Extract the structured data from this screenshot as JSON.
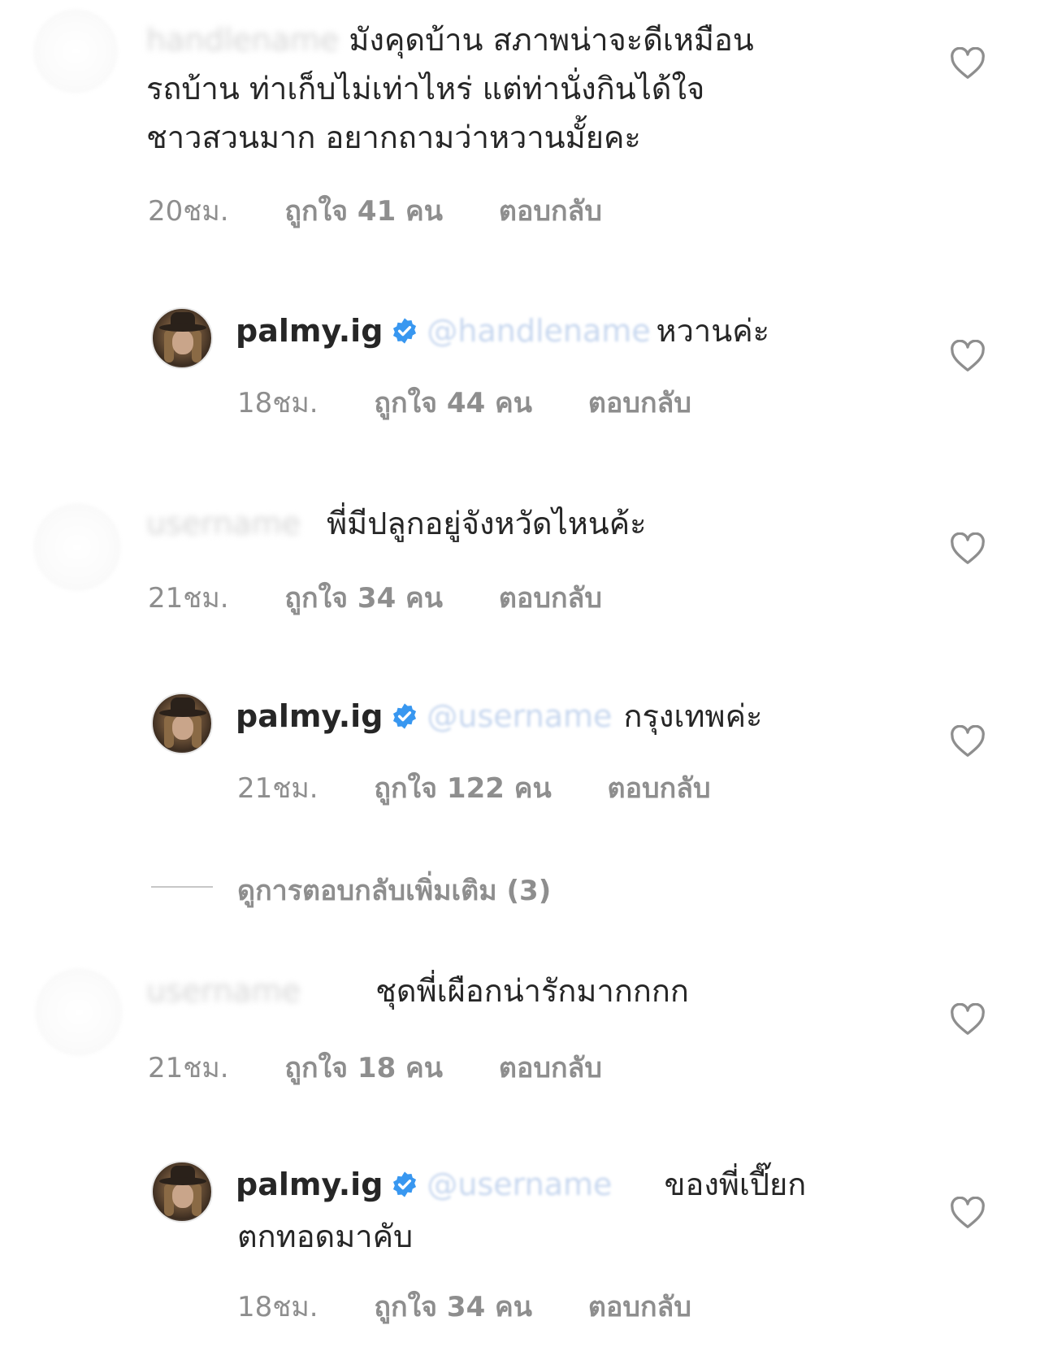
{
  "comments": [
    {
      "username_blurred": "handlename",
      "text_lines": [
        "มังคุดบ้าน สภาพน่าจะดีเหมือน",
        "รถบ้าน ท่าเก็บไม่เท่าไหร่ แต่ท่านั่งกินได้ใจ",
        "ชาวสวนมาก อยากถามว่าหวานมั้ยคะ"
      ],
      "time": "20ชม.",
      "likes": "ถูกใจ 41 คน",
      "reply": "ตอบกลับ"
    },
    {
      "username": "palmy.ig",
      "mention_blurred": "@handlename",
      "text": "หวานค่ะ",
      "time": "18ชม.",
      "likes": "ถูกใจ 44 คน",
      "reply": "ตอบกลับ"
    },
    {
      "username_blurred": "username",
      "text": "พี่มีปลูกอยู่จังหวัดไหนค้ะ",
      "time": "21ชม.",
      "likes": "ถูกใจ 34 คน",
      "reply": "ตอบกลับ"
    },
    {
      "username": "palmy.ig",
      "mention_blurred": "@username",
      "text": "กรุงเทพค่ะ",
      "time": "21ชม.",
      "likes": "ถูกใจ 122 คน",
      "reply": "ตอบกลับ"
    },
    {
      "username_blurred": "username",
      "text": "ชุดพี่เผือกน่ารักมากกกก",
      "time": "21ชม.",
      "likes": "ถูกใจ 18 คน",
      "reply": "ตอบกลับ"
    },
    {
      "username": "palmy.ig",
      "mention_blurred": "@username",
      "text_lines": [
        "ของพี่เปี๊ยก",
        "ตกทอดมาคับ"
      ],
      "time": "18ชม.",
      "likes": "ถูกใจ 34 คน",
      "reply": "ตอบกลับ"
    }
  ],
  "more_replies": "ดูการตอบกลับเพิ่มเติม (3)",
  "colors": {
    "text": "#262626",
    "meta": "#8e8e8e",
    "verified": "#3897f0"
  },
  "icons": {
    "like": "heart-outline-icon",
    "verified": "verified-badge-icon"
  }
}
